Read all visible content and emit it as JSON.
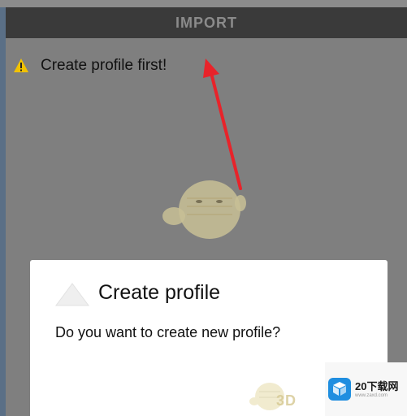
{
  "toolbar": {
    "title": "IMPORT"
  },
  "warning": {
    "text": "Create profile first!",
    "icon": "warning-icon"
  },
  "dialog": {
    "title": "Create profile",
    "message": "Do you want to create new profile?"
  },
  "watermark": {
    "text": "3D",
    "brand": "20下载网",
    "sub": "www.zaxd.com"
  },
  "colors": {
    "toolbar": "#3a3a3a",
    "arrow": "#e8232a",
    "overlay": "#7f7f7f",
    "warning": "#f2c200"
  }
}
